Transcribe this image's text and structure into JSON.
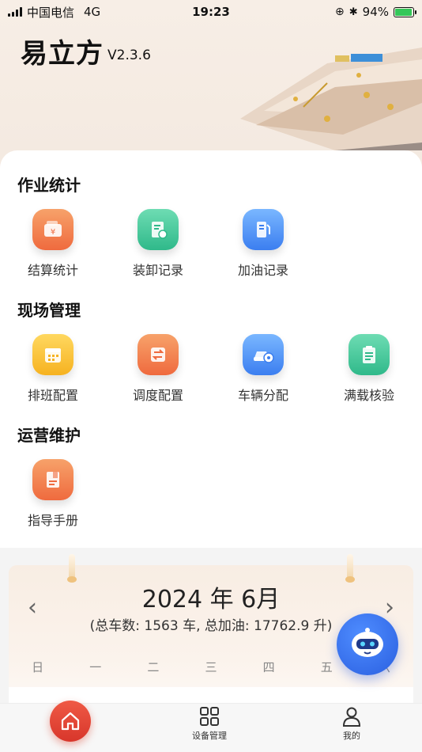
{
  "status": {
    "carrier": "中国电信",
    "network": "4G",
    "time": "19:23",
    "battery": "94%"
  },
  "header": {
    "title": "易立方",
    "version": "V2.3.6"
  },
  "sections": [
    {
      "title": "作业统计",
      "items": [
        {
          "label": "结算统计",
          "icon": "wallet-icon",
          "color": "orange"
        },
        {
          "label": "装卸记录",
          "icon": "document-clock-icon",
          "color": "green"
        },
        {
          "label": "加油记录",
          "icon": "fuel-pump-icon",
          "color": "blue"
        }
      ]
    },
    {
      "title": "现场管理",
      "items": [
        {
          "label": "排班配置",
          "icon": "calendar-icon",
          "color": "yellow"
        },
        {
          "label": "调度配置",
          "icon": "swap-icon",
          "color": "orange"
        },
        {
          "label": "车辆分配",
          "icon": "car-gear-icon",
          "color": "blue"
        },
        {
          "label": "满载核验",
          "icon": "clipboard-icon",
          "color": "green"
        }
      ]
    },
    {
      "title": "运营维护",
      "items": [
        {
          "label": "指导手册",
          "icon": "manual-icon",
          "color": "orange"
        }
      ]
    }
  ],
  "calendar": {
    "title": "2024 年 6月",
    "summary": "(总车数: 1563 车, 总加油: 17762.9 升)",
    "weekdays": [
      "日",
      "一",
      "二",
      "三",
      "四",
      "五",
      "六"
    ]
  },
  "tabbar": {
    "items": [
      {
        "label": "",
        "icon": "home-icon",
        "active": true
      },
      {
        "label": "设备管理",
        "icon": "grid-icon",
        "active": false
      },
      {
        "label": "我的",
        "icon": "user-icon",
        "active": false
      }
    ]
  },
  "colors": {
    "accent_red": "#d8362b",
    "orange": "#ef6a3e",
    "green": "#2fb98a",
    "blue": "#3b7ef0",
    "yellow": "#f6b220"
  }
}
